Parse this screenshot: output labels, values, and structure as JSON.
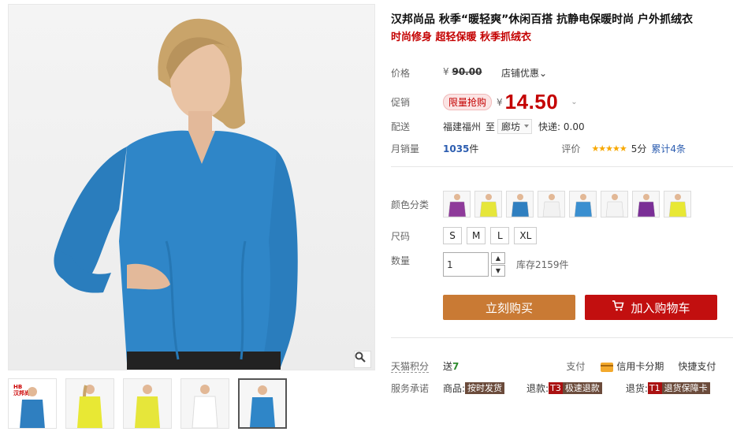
{
  "product": {
    "title": "汉邦尚品 秋季“暖轻爽”休闲百搭 抗静电保暖时尚 户外抓绒衣",
    "subtitle": "时尚修身 超轻保暖 秋季抓绒衣"
  },
  "price": {
    "label": "价格",
    "currency": "¥",
    "original": "90.00",
    "promo_link": "店铺优惠⌄"
  },
  "promotion": {
    "label": "促销",
    "tag": "限量抢购",
    "currency": "¥",
    "price": "14.50"
  },
  "shipping": {
    "label": "配送",
    "origin": "福建福州",
    "to": "至",
    "destination": "廊坊",
    "fee_text": "快递: 0.00"
  },
  "sales": {
    "label": "月销量",
    "count": "1035",
    "unit": "件",
    "rating_label": "评价",
    "stars": "★★★★★",
    "score": "5分",
    "reviews": "累计4条"
  },
  "color": {
    "label": "颜色分类",
    "swatches": [
      "#8e3a9a",
      "#e6e63a",
      "#2f7fc0",
      "#f2f2f2",
      "#3a8fd0",
      "#f4f4f4",
      "#7a2f96",
      "#e8e834"
    ]
  },
  "size": {
    "label": "尺码",
    "options": [
      "S",
      "M",
      "L",
      "XL"
    ]
  },
  "quantity": {
    "label": "数量",
    "value": "1",
    "up": "▲",
    "down": "▼",
    "stock": "库存2159件"
  },
  "actions": {
    "buy_now": "立刻购买",
    "add_cart": "加入购物车"
  },
  "points": {
    "label": "天猫积分",
    "send": "送",
    "amount": "7",
    "pay_label": "支付",
    "credit": "信用卡分期",
    "quick": "快捷支付"
  },
  "service": {
    "label": "服务承诺",
    "goods": "商品:",
    "ship_fast": "按时发货",
    "refund": "退款:",
    "refund_code": "T3",
    "refund_tag": "极速退款",
    "return": "退货:",
    "return_code": "T1",
    "return_tag": "退货保障卡"
  },
  "gallery": {
    "logo_text": "HB\n汉邦尚品",
    "thumb_colors": [
      "#2f7fc0",
      "#e8e834",
      "#e6e63a",
      "#f6f6f6",
      "#2f86c8"
    ]
  }
}
